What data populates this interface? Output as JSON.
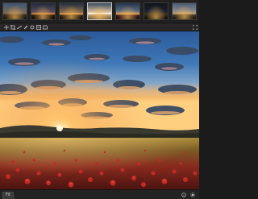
{
  "filmstrip": {
    "thumbnails": [
      {
        "name": "thumbnail-1",
        "style": "t1"
      },
      {
        "name": "thumbnail-2",
        "style": "t2"
      },
      {
        "name": "thumbnail-3",
        "style": "t3"
      },
      {
        "name": "thumbnail-4",
        "style": "t4",
        "selected": true
      },
      {
        "name": "thumbnail-5",
        "style": "t5"
      },
      {
        "name": "thumbnail-6",
        "style": "t6"
      },
      {
        "name": "thumbnail-7",
        "style": "t7"
      },
      {
        "name": "thumbnail-8",
        "style": "t8"
      }
    ]
  },
  "toolbar": {
    "tools": [
      "pan-icon",
      "crop-icon",
      "straighten-icon",
      "eyedropper-icon",
      "clone-icon",
      "gradient-icon",
      "keystone-icon",
      "fullscreen-icon"
    ]
  },
  "statusbar": {
    "zoom_label": "Fit",
    "icons": [
      "info-icon",
      "settings-icon"
    ]
  },
  "colors": {
    "ui_background": "#1f1f1f",
    "accent_sun": "#ffb347",
    "sky_top": "#2f5d9c",
    "field_red": "#b32a28"
  }
}
